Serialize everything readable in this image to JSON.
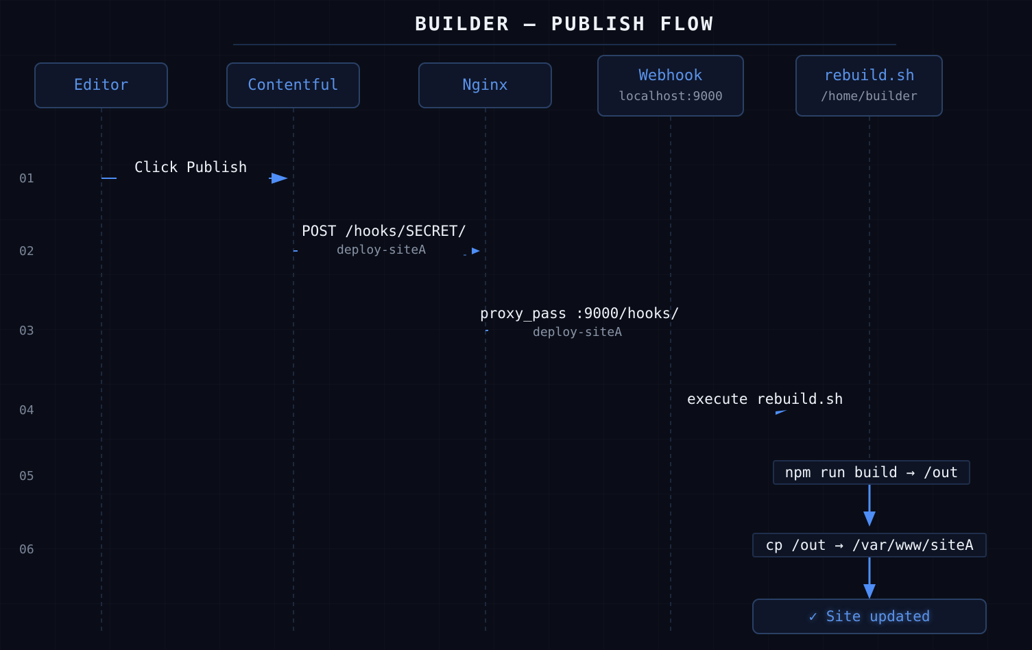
{
  "title": "BUILDER — PUBLISH FLOW",
  "actors": [
    {
      "name": "Editor",
      "sub": ""
    },
    {
      "name": "Contentful",
      "sub": ""
    },
    {
      "name": "Nginx",
      "sub": ""
    },
    {
      "name": "Webhook",
      "sub": "localhost:9000"
    },
    {
      "name": "rebuild.sh",
      "sub": "/home/builder"
    }
  ],
  "steps": [
    {
      "num": "01",
      "label": "Click Publish",
      "sub": ""
    },
    {
      "num": "02",
      "label": "POST /hooks/SECRET/",
      "sub": "deploy-siteA"
    },
    {
      "num": "03",
      "label": "proxy_pass :9000/hooks/",
      "sub": "deploy-siteA"
    },
    {
      "num": "04",
      "label": "execute rebuild.sh",
      "sub": ""
    },
    {
      "num": "05",
      "label": "npm run build → /out",
      "sub": ""
    },
    {
      "num": "06",
      "label": "cp /out → /var/www/siteA",
      "sub": ""
    }
  ],
  "result": "✓ Site updated",
  "colors": {
    "accent": "#4f8ef7",
    "background": "#0a0d17",
    "box_border": "#2a4066"
  }
}
